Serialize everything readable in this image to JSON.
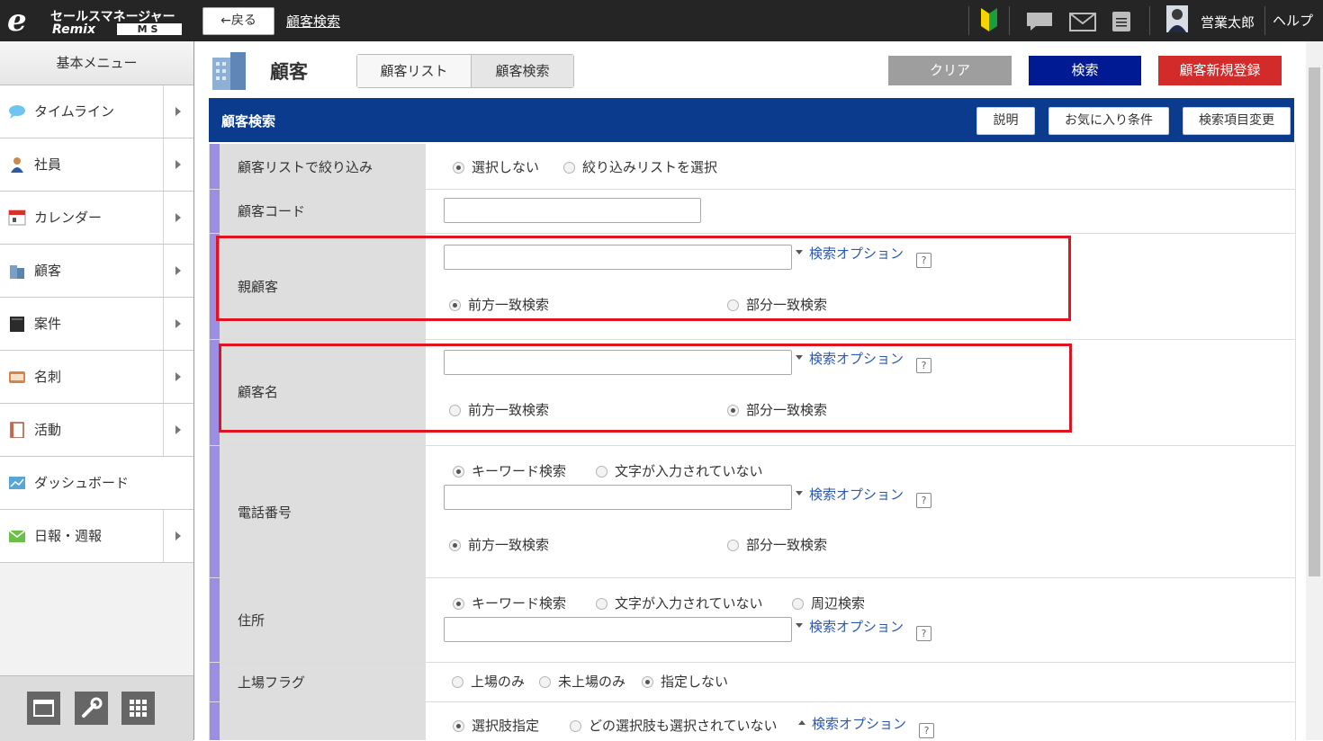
{
  "topbar": {
    "logo": {
      "mark": "e",
      "line1": "セールスマネージャー",
      "line2": "Remix",
      "line3": "MS"
    },
    "back_label": "←戻る",
    "breadcrumb": "顧客検索",
    "user_name": "営業太郎",
    "help_label": "ヘルプ",
    "icons": [
      "beginner-mark-icon",
      "chat-icon",
      "mail-icon",
      "memo-icon",
      "user-avatar"
    ]
  },
  "sidebar": {
    "title": "基本メニュー",
    "items": [
      {
        "label": "タイムライン",
        "icon": "speech-bubble-icon",
        "has_submenu": true
      },
      {
        "label": "社員",
        "icon": "person-icon",
        "has_submenu": true
      },
      {
        "label": "カレンダー",
        "icon": "calendar-icon",
        "has_submenu": true
      },
      {
        "label": "顧客",
        "icon": "building-icon",
        "has_submenu": true
      },
      {
        "label": "案件",
        "icon": "folder-icon",
        "has_submenu": true
      },
      {
        "label": "名刺",
        "icon": "business-card-icon",
        "has_submenu": true
      },
      {
        "label": "活動",
        "icon": "notebook-icon",
        "has_submenu": true
      },
      {
        "label": "ダッシュボード",
        "icon": "dashboard-icon",
        "has_submenu": false
      },
      {
        "label": "日報・週報",
        "icon": "envelope-report-icon",
        "has_submenu": true
      }
    ],
    "tools": [
      "window-icon",
      "wrench-icon",
      "grid-icon"
    ]
  },
  "main": {
    "title": "顧客",
    "tabs": [
      "顧客リスト",
      "顧客検索"
    ],
    "actions": {
      "clear": "クリア",
      "search": "検索",
      "new": "顧客新規登録"
    },
    "panel": {
      "title": "顧客検索",
      "buttons": [
        "説明",
        "お気に入り条件",
        "検索項目変更"
      ]
    },
    "option_label": "検索オプション",
    "help_mark": "?",
    "rows": {
      "list_filter": {
        "label": "顧客リストで絞り込み",
        "options": [
          "選択しない",
          "絞り込みリストを選択"
        ],
        "selected": "選択しない"
      },
      "code": {
        "label": "顧客コード",
        "value": ""
      },
      "parent": {
        "label": "親顧客",
        "value": "",
        "options": [
          "前方一致検索",
          "部分一致検索"
        ],
        "selected": "前方一致検索"
      },
      "name": {
        "label": "顧客名",
        "value": "",
        "options": [
          "前方一致検索",
          "部分一致検索"
        ],
        "selected": "部分一致検索"
      },
      "phone": {
        "label": "電話番号",
        "mode_options": [
          "キーワード検索",
          "文字が入力されていない"
        ],
        "mode_selected": "キーワード検索",
        "value": "",
        "options": [
          "前方一致検索",
          "部分一致検索"
        ],
        "selected": "前方一致検索"
      },
      "address": {
        "label": "住所",
        "mode_options": [
          "キーワード検索",
          "文字が入力されていない",
          "周辺検索"
        ],
        "mode_selected": "キーワード検索",
        "value": ""
      },
      "listed": {
        "label": "上場フラグ",
        "options": [
          "上場のみ",
          "未上場のみ",
          "指定しない"
        ],
        "selected": "指定しない"
      },
      "last": {
        "label": "",
        "options": [
          "選択肢指定",
          "どの選択肢も選択されていない"
        ],
        "selected": "選択肢指定"
      }
    }
  },
  "colors": {
    "topbar": "#252525",
    "panel_header": "#0b3b8c",
    "search_button": "#001a94",
    "new_button": "#d32a2a",
    "clear_button": "#9e9e9e",
    "label_accent": "#9c8ee2",
    "highlight_box": "#e01420",
    "link": "#2a57b5"
  }
}
